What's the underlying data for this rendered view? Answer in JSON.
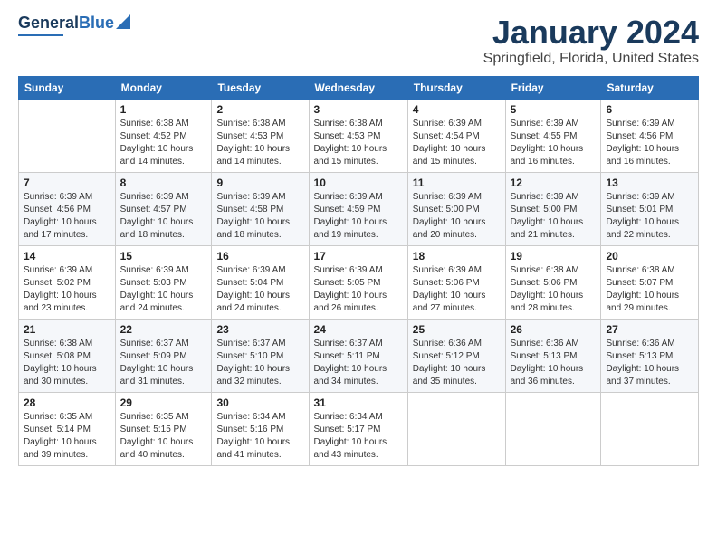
{
  "logo": {
    "line1": "General",
    "line2": "Blue"
  },
  "title": "January 2024",
  "subtitle": "Springfield, Florida, United States",
  "days_header": [
    "Sunday",
    "Monday",
    "Tuesday",
    "Wednesday",
    "Thursday",
    "Friday",
    "Saturday"
  ],
  "weeks": [
    [
      {
        "num": "",
        "info": ""
      },
      {
        "num": "1",
        "info": "Sunrise: 6:38 AM\nSunset: 4:52 PM\nDaylight: 10 hours\nand 14 minutes."
      },
      {
        "num": "2",
        "info": "Sunrise: 6:38 AM\nSunset: 4:53 PM\nDaylight: 10 hours\nand 14 minutes."
      },
      {
        "num": "3",
        "info": "Sunrise: 6:38 AM\nSunset: 4:53 PM\nDaylight: 10 hours\nand 15 minutes."
      },
      {
        "num": "4",
        "info": "Sunrise: 6:39 AM\nSunset: 4:54 PM\nDaylight: 10 hours\nand 15 minutes."
      },
      {
        "num": "5",
        "info": "Sunrise: 6:39 AM\nSunset: 4:55 PM\nDaylight: 10 hours\nand 16 minutes."
      },
      {
        "num": "6",
        "info": "Sunrise: 6:39 AM\nSunset: 4:56 PM\nDaylight: 10 hours\nand 16 minutes."
      }
    ],
    [
      {
        "num": "7",
        "info": "Sunrise: 6:39 AM\nSunset: 4:56 PM\nDaylight: 10 hours\nand 17 minutes."
      },
      {
        "num": "8",
        "info": "Sunrise: 6:39 AM\nSunset: 4:57 PM\nDaylight: 10 hours\nand 18 minutes."
      },
      {
        "num": "9",
        "info": "Sunrise: 6:39 AM\nSunset: 4:58 PM\nDaylight: 10 hours\nand 18 minutes."
      },
      {
        "num": "10",
        "info": "Sunrise: 6:39 AM\nSunset: 4:59 PM\nDaylight: 10 hours\nand 19 minutes."
      },
      {
        "num": "11",
        "info": "Sunrise: 6:39 AM\nSunset: 5:00 PM\nDaylight: 10 hours\nand 20 minutes."
      },
      {
        "num": "12",
        "info": "Sunrise: 6:39 AM\nSunset: 5:00 PM\nDaylight: 10 hours\nand 21 minutes."
      },
      {
        "num": "13",
        "info": "Sunrise: 6:39 AM\nSunset: 5:01 PM\nDaylight: 10 hours\nand 22 minutes."
      }
    ],
    [
      {
        "num": "14",
        "info": "Sunrise: 6:39 AM\nSunset: 5:02 PM\nDaylight: 10 hours\nand 23 minutes."
      },
      {
        "num": "15",
        "info": "Sunrise: 6:39 AM\nSunset: 5:03 PM\nDaylight: 10 hours\nand 24 minutes."
      },
      {
        "num": "16",
        "info": "Sunrise: 6:39 AM\nSunset: 5:04 PM\nDaylight: 10 hours\nand 24 minutes."
      },
      {
        "num": "17",
        "info": "Sunrise: 6:39 AM\nSunset: 5:05 PM\nDaylight: 10 hours\nand 26 minutes."
      },
      {
        "num": "18",
        "info": "Sunrise: 6:39 AM\nSunset: 5:06 PM\nDaylight: 10 hours\nand 27 minutes."
      },
      {
        "num": "19",
        "info": "Sunrise: 6:38 AM\nSunset: 5:06 PM\nDaylight: 10 hours\nand 28 minutes."
      },
      {
        "num": "20",
        "info": "Sunrise: 6:38 AM\nSunset: 5:07 PM\nDaylight: 10 hours\nand 29 minutes."
      }
    ],
    [
      {
        "num": "21",
        "info": "Sunrise: 6:38 AM\nSunset: 5:08 PM\nDaylight: 10 hours\nand 30 minutes."
      },
      {
        "num": "22",
        "info": "Sunrise: 6:37 AM\nSunset: 5:09 PM\nDaylight: 10 hours\nand 31 minutes."
      },
      {
        "num": "23",
        "info": "Sunrise: 6:37 AM\nSunset: 5:10 PM\nDaylight: 10 hours\nand 32 minutes."
      },
      {
        "num": "24",
        "info": "Sunrise: 6:37 AM\nSunset: 5:11 PM\nDaylight: 10 hours\nand 34 minutes."
      },
      {
        "num": "25",
        "info": "Sunrise: 6:36 AM\nSunset: 5:12 PM\nDaylight: 10 hours\nand 35 minutes."
      },
      {
        "num": "26",
        "info": "Sunrise: 6:36 AM\nSunset: 5:13 PM\nDaylight: 10 hours\nand 36 minutes."
      },
      {
        "num": "27",
        "info": "Sunrise: 6:36 AM\nSunset: 5:13 PM\nDaylight: 10 hours\nand 37 minutes."
      }
    ],
    [
      {
        "num": "28",
        "info": "Sunrise: 6:35 AM\nSunset: 5:14 PM\nDaylight: 10 hours\nand 39 minutes."
      },
      {
        "num": "29",
        "info": "Sunrise: 6:35 AM\nSunset: 5:15 PM\nDaylight: 10 hours\nand 40 minutes."
      },
      {
        "num": "30",
        "info": "Sunrise: 6:34 AM\nSunset: 5:16 PM\nDaylight: 10 hours\nand 41 minutes."
      },
      {
        "num": "31",
        "info": "Sunrise: 6:34 AM\nSunset: 5:17 PM\nDaylight: 10 hours\nand 43 minutes."
      },
      {
        "num": "",
        "info": ""
      },
      {
        "num": "",
        "info": ""
      },
      {
        "num": "",
        "info": ""
      }
    ]
  ]
}
